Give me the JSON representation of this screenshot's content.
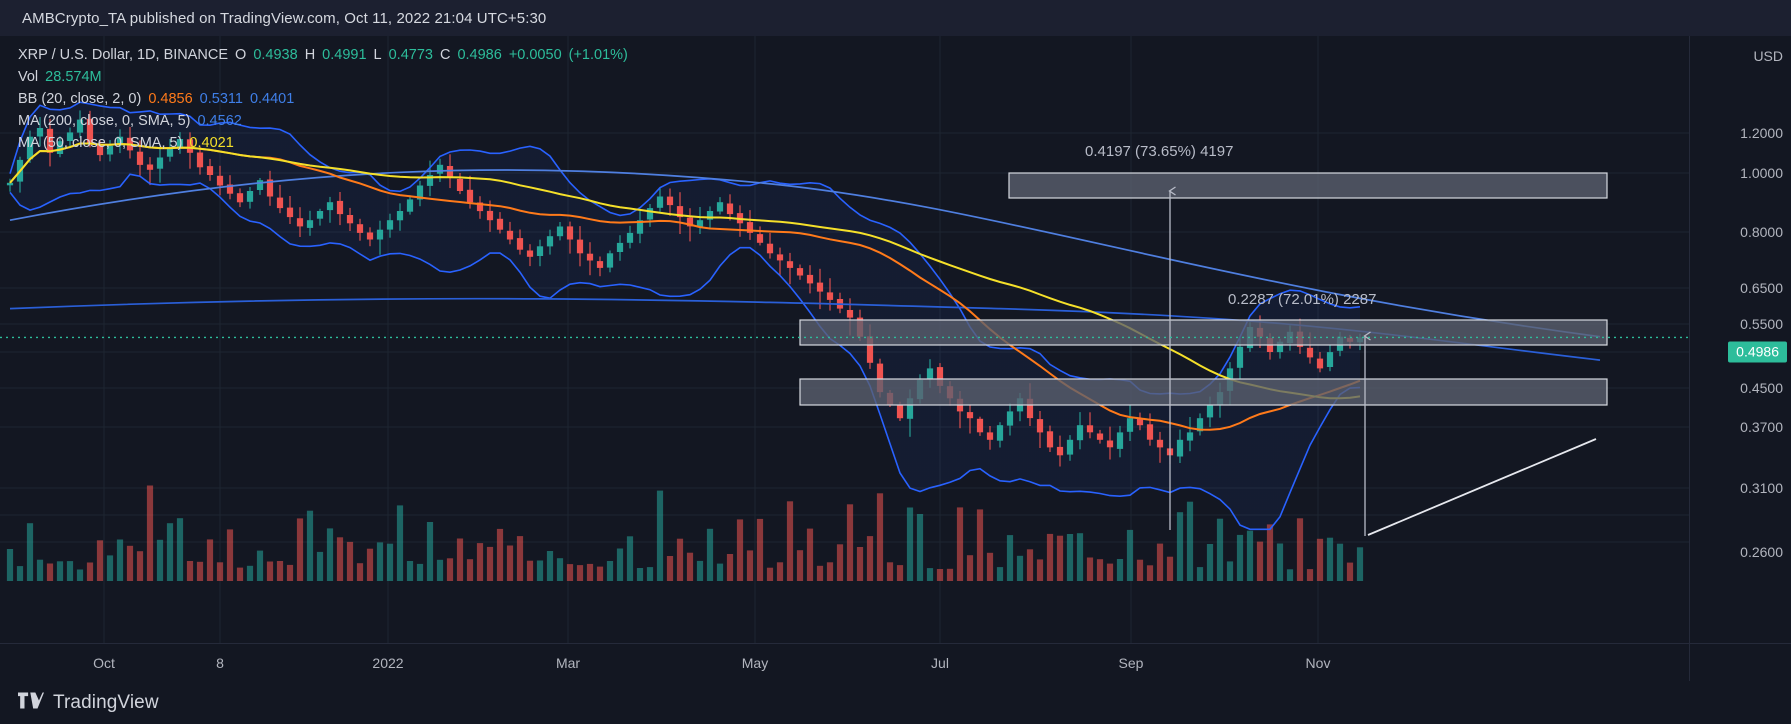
{
  "attribution": {
    "text": "AMBCrypto_TA published on TradingView.com, Oct 11, 2022 21:04 UTC+5:30"
  },
  "legend": {
    "symbol": "XRP / U.S. Dollar, 1D, BINANCE",
    "ohlc": {
      "open_label": "O",
      "open": "0.4938",
      "high_label": "H",
      "high": "0.4991",
      "low_label": "L",
      "low": "0.4773",
      "close_label": "C",
      "close": "0.4986",
      "change": "+0.0050",
      "change_pct": "(+1.01%)"
    },
    "volume": {
      "label": "Vol",
      "value": "28.574M"
    },
    "bb": {
      "label": "BB (20, close, 2, 0)",
      "v1": "0.4856",
      "v2": "0.5311",
      "v3": "0.4401"
    },
    "ma200": {
      "label": "MA (200, close, 0, SMA, 5)",
      "value": "0.4562"
    },
    "ma50": {
      "label": "MA (50, close, 0, SMA, 5)",
      "value": "0.4021"
    }
  },
  "price_axis": {
    "unit": "USD",
    "ticks": [
      "1.2000",
      "1.0000",
      "0.8000",
      "0.6500",
      "0.5500",
      "0.4500",
      "0.3700",
      "0.3100",
      "0.2600"
    ],
    "current_price": "0.4986"
  },
  "time_axis": {
    "ticks": [
      "Oct",
      "8",
      "2022",
      "Mar",
      "May",
      "Jul",
      "Sep",
      "Nov"
    ]
  },
  "annotations": {
    "upper": "0.4197 (73.65%) 4197",
    "lower": "0.2287 (72.01%) 2287"
  },
  "footer": {
    "brand": "TradingView"
  },
  "colors": {
    "background": "#131722",
    "attrib_bar": "#1c2030",
    "up_candle": "#26a69a",
    "down_candle": "#ef5350",
    "bollinger": "#2962ff",
    "ma200": "#ff7a1a",
    "ma50": "#f5e02a",
    "current_price_badge": "#2dbd9b",
    "zone_fill": "#5b6070",
    "zone_border": "#d6d9e0",
    "grid": "#1e2430",
    "text": "#b2b5be"
  },
  "chart_data": {
    "type": "line",
    "title": "XRP / U.S. Dollar, 1D, BINANCE",
    "xlabel": "",
    "ylabel": "USD",
    "ylim": [
      0.22,
      1.3
    ],
    "grid": true,
    "legend_position": "top-left",
    "x_tick_labels": [
      "Oct",
      "8",
      "2022",
      "Mar",
      "May",
      "Jul",
      "Sep",
      "Nov"
    ],
    "y_tick_values": [
      1.2,
      1.0,
      0.8,
      0.65,
      0.55,
      0.45,
      0.37,
      0.31,
      0.26
    ],
    "current_price": 0.4986,
    "ohlc_summary": {
      "open": 0.4938,
      "high": 0.4991,
      "low": 0.4773,
      "close": 0.4986,
      "change": 0.005,
      "change_pct": 1.01
    },
    "volume_summary": "28.574M",
    "indicators": [
      {
        "name": "BB (20, close, 2, 0)",
        "color": "#2962ff",
        "values": [
          0.4856,
          0.5311,
          0.4401
        ]
      },
      {
        "name": "MA (200, close, 0, SMA, 5)",
        "color": "#ff7a1a",
        "value": 0.4562
      },
      {
        "name": "MA (50, close, 0, SMA, 5)",
        "color": "#f5e02a",
        "value": 0.4021
      }
    ],
    "zones": [
      {
        "name": "upper-resistance-zone",
        "price_top": 1.01,
        "price_bottom": 0.955
      },
      {
        "name": "mid-resistance-zone",
        "price_top": 0.57,
        "price_bottom": 0.52
      },
      {
        "name": "lower-support-zone",
        "price_top": 0.468,
        "price_bottom": 0.425
      }
    ],
    "measure_arrows": [
      {
        "name": "upper-measure-arrow",
        "label": "0.4197 (73.65%) 4197",
        "from_price": 0.31,
        "to_price": 0.985
      },
      {
        "name": "lower-measure-arrow",
        "label": "0.2287 (72.01%) 2287",
        "from_price": 0.305,
        "to_price": 0.54
      }
    ],
    "series": [
      {
        "name": "candles_close",
        "values": [
          0.93,
          1.02,
          1.12,
          1.16,
          1.05,
          1.1,
          1.14,
          1.2,
          1.09,
          1.04,
          1.08,
          1.12,
          1.06,
          1.0,
          0.98,
          1.03,
          1.07,
          1.11,
          1.05,
          0.99,
          0.96,
          0.92,
          0.89,
          0.86,
          0.9,
          0.94,
          0.88,
          0.84,
          0.81,
          0.78,
          0.8,
          0.83,
          0.86,
          0.82,
          0.79,
          0.76,
          0.74,
          0.77,
          0.8,
          0.83,
          0.87,
          0.92,
          0.96,
          1.0,
          0.95,
          0.9,
          0.86,
          0.83,
          0.8,
          0.77,
          0.74,
          0.71,
          0.69,
          0.72,
          0.75,
          0.78,
          0.74,
          0.7,
          0.68,
          0.66,
          0.7,
          0.73,
          0.76,
          0.8,
          0.84,
          0.88,
          0.85,
          0.81,
          0.78,
          0.8,
          0.83,
          0.86,
          0.82,
          0.79,
          0.76,
          0.73,
          0.7,
          0.68,
          0.66,
          0.64,
          0.62,
          0.6,
          0.58,
          0.56,
          0.54,
          0.5,
          0.45,
          0.4,
          0.38,
          0.36,
          0.39,
          0.42,
          0.44,
          0.41,
          0.39,
          0.37,
          0.36,
          0.34,
          0.33,
          0.35,
          0.37,
          0.39,
          0.36,
          0.34,
          0.32,
          0.31,
          0.33,
          0.35,
          0.34,
          0.33,
          0.32,
          0.34,
          0.36,
          0.35,
          0.33,
          0.32,
          0.31,
          0.33,
          0.34,
          0.36,
          0.38,
          0.4,
          0.44,
          0.48,
          0.52,
          0.5,
          0.47,
          0.49,
          0.51,
          0.48,
          0.46,
          0.44,
          0.47,
          0.5,
          0.49,
          0.4986
        ]
      }
    ]
  }
}
